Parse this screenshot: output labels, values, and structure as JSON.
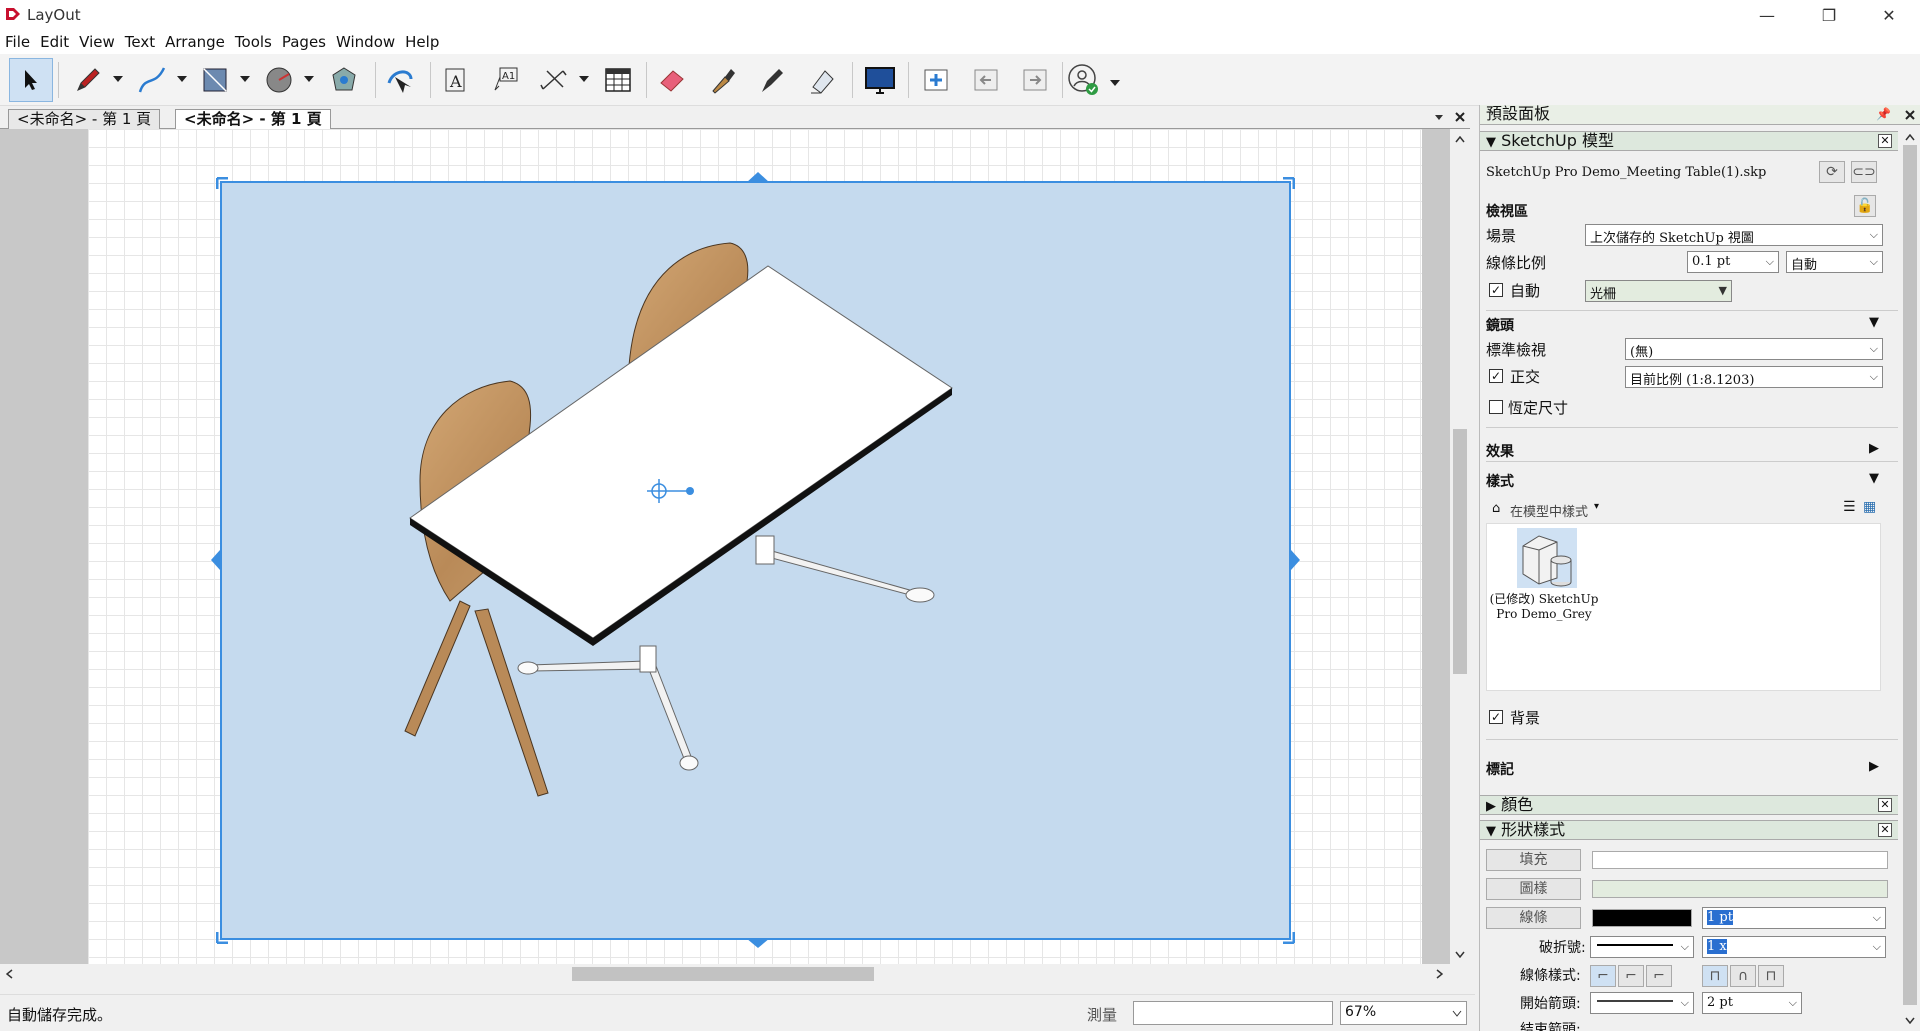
{
  "window": {
    "title": "LayOut",
    "minimize": "—",
    "maximize": "❐",
    "close": "✕"
  },
  "menu": [
    "File",
    "Edit",
    "View",
    "Text",
    "Arrange",
    "Tools",
    "Pages",
    "Window",
    "Help"
  ],
  "toolbar": {
    "icons": [
      "select-icon",
      "pencil-icon",
      "curve-icon",
      "rectangle-icon",
      "circle-icon",
      "polygon-icon",
      "orbit-icon",
      "text-icon",
      "label-icon",
      "dimension-icon",
      "table-icon",
      "eraser-icon",
      "eyedropper-icon",
      "split-icon",
      "join-icon",
      "presentation-icon",
      "add-page-icon",
      "prev-page-icon",
      "next-page-icon",
      "account-icon"
    ]
  },
  "tabs": [
    {
      "label": "<未命名> - 第 1 頁",
      "active": false
    },
    {
      "label": "<未命名> - 第 1 頁",
      "active": true
    }
  ],
  "status": {
    "text": "自動儲存完成。",
    "measure_label": "測量",
    "measure_value": "",
    "zoom": "67%"
  },
  "panel": {
    "title": "預設面板",
    "sketchup": {
      "title": "SketchUp 模型",
      "file": "SketchUp Pro Demo_Meeting Table(1).skp",
      "viewport_section": "檢視區",
      "scene_label": "場景",
      "scene_value": "上次儲存的 SketchUp 視圖",
      "line_scale_label": "線條比例",
      "line_scale_value": "0.1 pt",
      "line_scale_mode": "自動",
      "auto_label": "自動",
      "render_mode": "光柵",
      "camera_section": "鏡頭",
      "standard_view_label": "標準檢視",
      "standard_view_value": "(無)",
      "ortho_label": "正交",
      "ortho_value": "目前比例 (1:8.1203)",
      "preserve_label": "恆定尺寸",
      "effects_section": "效果",
      "styles_section": "樣式",
      "styles_source": "在模型中樣式",
      "style_name_line1": "(已修改) SketchUp",
      "style_name_line2": "Pro Demo_Grey",
      "background_label": "背景",
      "tags_section": "標記"
    },
    "colors": {
      "title": "顏色"
    },
    "shape_style": {
      "title": "形狀樣式",
      "fill_label": "填充",
      "pattern_label": "圖樣",
      "stroke_label": "線條",
      "stroke_width": "1 pt",
      "dash_label": "破折號:",
      "dash_scale": "1 x",
      "line_style_label": "線條樣式:",
      "start_arrow_label": "開始箭頭:",
      "start_arrow_size": "2 pt",
      "end_arrow_label": "結束箭頭:"
    }
  },
  "colors": {
    "accent": "#3b8ee0",
    "viewport_bg": "#c5daee",
    "panel_header": "#dde8dd"
  }
}
